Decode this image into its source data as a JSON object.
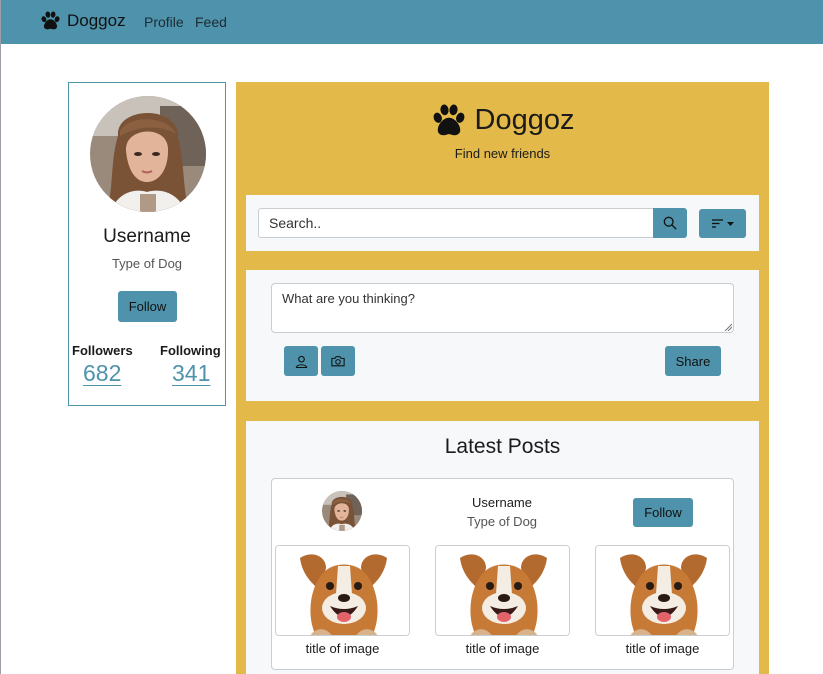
{
  "navbar": {
    "brand": "Doggoz",
    "links": [
      "Profile",
      "Feed"
    ]
  },
  "profile": {
    "username": "Username",
    "type": "Type of Dog",
    "follow_label": "Follow",
    "followers_label": "Followers",
    "followers_count": "682",
    "following_label": "Following",
    "following_count": "341"
  },
  "hero": {
    "title": "Doggoz",
    "subtitle": "Find new friends"
  },
  "search": {
    "placeholder": "Search.."
  },
  "compose": {
    "placeholder": "What are you thinking?",
    "share_label": "Share"
  },
  "posts": {
    "heading": "Latest Posts",
    "card": {
      "username": "Username",
      "type": "Type of Dog",
      "follow_label": "Follow",
      "images": [
        {
          "title": "title of image"
        },
        {
          "title": "title of image"
        },
        {
          "title": "title of image"
        }
      ]
    }
  },
  "colors": {
    "navbar": "#4e93ab",
    "accent": "#4e93ab",
    "main_panel": "#e3b94a",
    "section_bg": "#f7f8f9"
  },
  "icons": [
    "paw-icon",
    "search-icon",
    "filter-icon",
    "caret-down-icon",
    "user-icon",
    "camera-icon"
  ]
}
